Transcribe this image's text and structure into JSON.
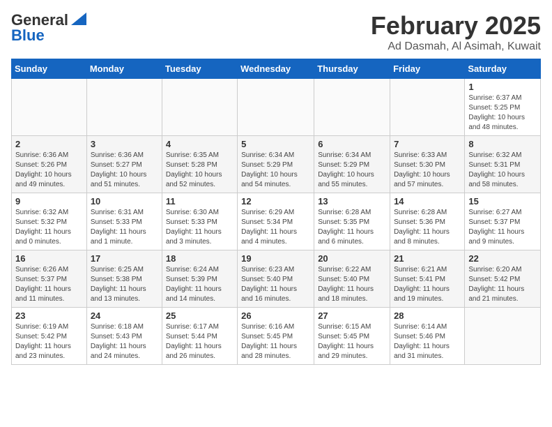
{
  "logo": {
    "part1": "General",
    "part2": "Blue"
  },
  "header": {
    "month": "February 2025",
    "location": "Ad Dasmah, Al Asimah, Kuwait"
  },
  "days_of_week": [
    "Sunday",
    "Monday",
    "Tuesday",
    "Wednesday",
    "Thursday",
    "Friday",
    "Saturday"
  ],
  "weeks": [
    [
      {
        "day": "",
        "info": ""
      },
      {
        "day": "",
        "info": ""
      },
      {
        "day": "",
        "info": ""
      },
      {
        "day": "",
        "info": ""
      },
      {
        "day": "",
        "info": ""
      },
      {
        "day": "",
        "info": ""
      },
      {
        "day": "1",
        "info": "Sunrise: 6:37 AM\nSunset: 5:25 PM\nDaylight: 10 hours\nand 48 minutes."
      }
    ],
    [
      {
        "day": "2",
        "info": "Sunrise: 6:36 AM\nSunset: 5:26 PM\nDaylight: 10 hours\nand 49 minutes."
      },
      {
        "day": "3",
        "info": "Sunrise: 6:36 AM\nSunset: 5:27 PM\nDaylight: 10 hours\nand 51 minutes."
      },
      {
        "day": "4",
        "info": "Sunrise: 6:35 AM\nSunset: 5:28 PM\nDaylight: 10 hours\nand 52 minutes."
      },
      {
        "day": "5",
        "info": "Sunrise: 6:34 AM\nSunset: 5:29 PM\nDaylight: 10 hours\nand 54 minutes."
      },
      {
        "day": "6",
        "info": "Sunrise: 6:34 AM\nSunset: 5:29 PM\nDaylight: 10 hours\nand 55 minutes."
      },
      {
        "day": "7",
        "info": "Sunrise: 6:33 AM\nSunset: 5:30 PM\nDaylight: 10 hours\nand 57 minutes."
      },
      {
        "day": "8",
        "info": "Sunrise: 6:32 AM\nSunset: 5:31 PM\nDaylight: 10 hours\nand 58 minutes."
      }
    ],
    [
      {
        "day": "9",
        "info": "Sunrise: 6:32 AM\nSunset: 5:32 PM\nDaylight: 11 hours\nand 0 minutes."
      },
      {
        "day": "10",
        "info": "Sunrise: 6:31 AM\nSunset: 5:33 PM\nDaylight: 11 hours\nand 1 minute."
      },
      {
        "day": "11",
        "info": "Sunrise: 6:30 AM\nSunset: 5:33 PM\nDaylight: 11 hours\nand 3 minutes."
      },
      {
        "day": "12",
        "info": "Sunrise: 6:29 AM\nSunset: 5:34 PM\nDaylight: 11 hours\nand 4 minutes."
      },
      {
        "day": "13",
        "info": "Sunrise: 6:28 AM\nSunset: 5:35 PM\nDaylight: 11 hours\nand 6 minutes."
      },
      {
        "day": "14",
        "info": "Sunrise: 6:28 AM\nSunset: 5:36 PM\nDaylight: 11 hours\nand 8 minutes."
      },
      {
        "day": "15",
        "info": "Sunrise: 6:27 AM\nSunset: 5:37 PM\nDaylight: 11 hours\nand 9 minutes."
      }
    ],
    [
      {
        "day": "16",
        "info": "Sunrise: 6:26 AM\nSunset: 5:37 PM\nDaylight: 11 hours\nand 11 minutes."
      },
      {
        "day": "17",
        "info": "Sunrise: 6:25 AM\nSunset: 5:38 PM\nDaylight: 11 hours\nand 13 minutes."
      },
      {
        "day": "18",
        "info": "Sunrise: 6:24 AM\nSunset: 5:39 PM\nDaylight: 11 hours\nand 14 minutes."
      },
      {
        "day": "19",
        "info": "Sunrise: 6:23 AM\nSunset: 5:40 PM\nDaylight: 11 hours\nand 16 minutes."
      },
      {
        "day": "20",
        "info": "Sunrise: 6:22 AM\nSunset: 5:40 PM\nDaylight: 11 hours\nand 18 minutes."
      },
      {
        "day": "21",
        "info": "Sunrise: 6:21 AM\nSunset: 5:41 PM\nDaylight: 11 hours\nand 19 minutes."
      },
      {
        "day": "22",
        "info": "Sunrise: 6:20 AM\nSunset: 5:42 PM\nDaylight: 11 hours\nand 21 minutes."
      }
    ],
    [
      {
        "day": "23",
        "info": "Sunrise: 6:19 AM\nSunset: 5:42 PM\nDaylight: 11 hours\nand 23 minutes."
      },
      {
        "day": "24",
        "info": "Sunrise: 6:18 AM\nSunset: 5:43 PM\nDaylight: 11 hours\nand 24 minutes."
      },
      {
        "day": "25",
        "info": "Sunrise: 6:17 AM\nSunset: 5:44 PM\nDaylight: 11 hours\nand 26 minutes."
      },
      {
        "day": "26",
        "info": "Sunrise: 6:16 AM\nSunset: 5:45 PM\nDaylight: 11 hours\nand 28 minutes."
      },
      {
        "day": "27",
        "info": "Sunrise: 6:15 AM\nSunset: 5:45 PM\nDaylight: 11 hours\nand 29 minutes."
      },
      {
        "day": "28",
        "info": "Sunrise: 6:14 AM\nSunset: 5:46 PM\nDaylight: 11 hours\nand 31 minutes."
      },
      {
        "day": "",
        "info": ""
      }
    ]
  ]
}
